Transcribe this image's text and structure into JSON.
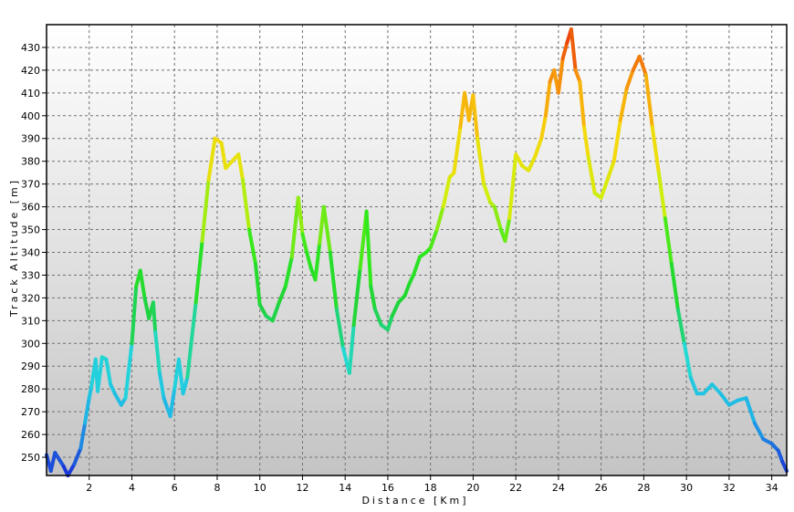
{
  "chart_data": {
    "type": "line",
    "xlabel": "Distance  [Km]",
    "ylabel": "Track  Altitude  [m]",
    "xlim": [
      0,
      34.7
    ],
    "ylim": [
      242,
      440
    ],
    "x_ticks": [
      2,
      4,
      6,
      8,
      10,
      12,
      14,
      16,
      18,
      20,
      22,
      24,
      26,
      28,
      30,
      32,
      34
    ],
    "y_ticks": [
      250,
      260,
      270,
      280,
      290,
      300,
      310,
      320,
      330,
      340,
      350,
      360,
      370,
      380,
      390,
      400,
      410,
      420,
      430
    ],
    "grid": true,
    "color_gradient": [
      "#1a2fd6",
      "#1fb0e8",
      "#22d9d9",
      "#1fd33a",
      "#2ee81c",
      "#d2ee0c",
      "#f6d80c",
      "#f69a0c",
      "#e8300a"
    ],
    "series": [
      {
        "x": [
          0,
          0.2,
          0.4,
          0.8,
          1.0,
          1.3,
          1.6,
          1.8,
          2.0,
          2.1,
          2.3,
          2.4,
          2.6,
          2.8,
          3.0,
          3.2,
          3.5,
          3.7,
          4.0,
          4.2,
          4.4,
          4.6,
          4.8,
          5.0,
          5.1,
          5.3,
          5.5,
          5.8,
          6.0,
          6.2,
          6.4,
          6.6,
          7.0,
          7.3,
          7.6,
          7.9,
          8.2,
          8.4,
          8.7,
          9.0,
          9.2,
          9.5,
          9.8,
          10.0,
          10.3,
          10.6,
          10.9,
          11.2,
          11.5,
          11.8,
          12.0,
          12.2,
          12.4,
          12.6,
          12.8,
          13.0,
          13.3,
          13.6,
          13.9,
          14.2,
          14.4,
          14.7,
          15.0,
          15.2,
          15.4,
          15.7,
          16.0,
          16.2,
          16.5,
          16.8,
          17.0,
          17.2,
          17.5,
          17.8,
          18.0,
          18.3,
          18.6,
          18.9,
          19.1,
          19.4,
          19.6,
          19.8,
          20.0,
          20.2,
          20.5,
          20.8,
          21.0,
          21.3,
          21.5,
          21.7,
          22.0,
          22.3,
          22.6,
          22.9,
          23.2,
          23.4,
          23.6,
          23.8,
          24.0,
          24.2,
          24.4,
          24.6,
          24.8,
          25.0,
          25.2,
          25.4,
          25.7,
          26.0,
          26.3,
          26.6,
          26.9,
          27.2,
          27.5,
          27.8,
          28.1,
          28.4,
          28.7,
          29.0,
          29.3,
          29.6,
          29.9,
          30.2,
          30.5,
          30.8,
          31.2,
          31.6,
          32.0,
          32.4,
          32.8,
          33.2,
          33.6,
          34.0,
          34.3,
          34.5,
          34.7
        ],
        "y": [
          251,
          244,
          252,
          246,
          242,
          247,
          254,
          265,
          276,
          281,
          293,
          279,
          294,
          293,
          282,
          278,
          273,
          276,
          300,
          325,
          332,
          320,
          311,
          318,
          305,
          287,
          276,
          268,
          280,
          293,
          278,
          285,
          318,
          345,
          372,
          390,
          388,
          377,
          380,
          383,
          372,
          350,
          335,
          317,
          312,
          310,
          318,
          325,
          338,
          364,
          348,
          340,
          333,
          328,
          344,
          360,
          340,
          315,
          298,
          287,
          308,
          333,
          358,
          325,
          315,
          308,
          306,
          312,
          318,
          321,
          326,
          330,
          338,
          340,
          342,
          350,
          360,
          373,
          375,
          395,
          410,
          398,
          409,
          390,
          370,
          362,
          360,
          350,
          345,
          355,
          383,
          378,
          376,
          382,
          390,
          400,
          415,
          420,
          410,
          425,
          432,
          438,
          420,
          415,
          395,
          382,
          366,
          364,
          372,
          380,
          398,
          412,
          420,
          426,
          418,
          395,
          375,
          355,
          335,
          315,
          300,
          285,
          278,
          278,
          282,
          278,
          273,
          275,
          276,
          265,
          258,
          256,
          253,
          248,
          244
        ]
      }
    ]
  }
}
